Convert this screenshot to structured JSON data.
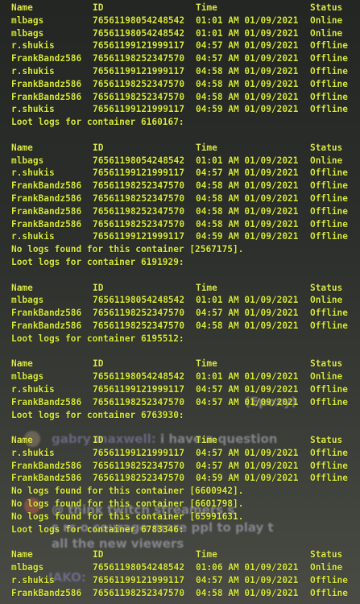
{
  "log": [
    {
      "type": "header",
      "name": "Name",
      "id": "ID",
      "time": "Time",
      "status": "Status"
    },
    {
      "type": "row",
      "name": "mlbags",
      "id": "76561198054248542",
      "time": "01:01 AM 01/09/2021",
      "status": "Online"
    },
    {
      "type": "row",
      "name": "mlbags",
      "id": "76561198054248542",
      "time": "01:01 AM 01/09/2021",
      "status": "Online"
    },
    {
      "type": "row",
      "name": "r.shukis",
      "id": "76561199121999117",
      "time": "04:57 AM 01/09/2021",
      "status": "Offline"
    },
    {
      "type": "row",
      "name": "FrankBandz586",
      "id": "76561198252347570",
      "time": "04:57 AM 01/09/2021",
      "status": "Offline"
    },
    {
      "type": "row",
      "name": "r.shukis",
      "id": "76561199121999117",
      "time": "04:58 AM 01/09/2021",
      "status": "Offline"
    },
    {
      "type": "row",
      "name": "FrankBandz586",
      "id": "76561198252347570",
      "time": "04:58 AM 01/09/2021",
      "status": "Offline"
    },
    {
      "type": "row",
      "name": "FrankBandz586",
      "id": "76561198252347570",
      "time": "04:58 AM 01/09/2021",
      "status": "Offline"
    },
    {
      "type": "row",
      "name": "r.shukis",
      "id": "76561199121999117",
      "time": "04:59 AM 01/09/2021",
      "status": "Offline"
    },
    {
      "type": "msg",
      "text": "Loot logs for container 6160167:"
    },
    {
      "type": "blank"
    },
    {
      "type": "header",
      "name": "Name",
      "id": "ID",
      "time": "Time",
      "status": "Status"
    },
    {
      "type": "row",
      "name": "mlbags",
      "id": "76561198054248542",
      "time": "01:01 AM 01/09/2021",
      "status": "Online"
    },
    {
      "type": "row",
      "name": "r.shukis",
      "id": "76561199121999117",
      "time": "04:57 AM 01/09/2021",
      "status": "Offline"
    },
    {
      "type": "row",
      "name": "FrankBandz586",
      "id": "76561198252347570",
      "time": "04:58 AM 01/09/2021",
      "status": "Offline"
    },
    {
      "type": "row",
      "name": "FrankBandz586",
      "id": "76561198252347570",
      "time": "04:58 AM 01/09/2021",
      "status": "Offline"
    },
    {
      "type": "row",
      "name": "FrankBandz586",
      "id": "76561198252347570",
      "time": "04:58 AM 01/09/2021",
      "status": "Offline"
    },
    {
      "type": "row",
      "name": "FrankBandz586",
      "id": "76561198252347570",
      "time": "04:58 AM 01/09/2021",
      "status": "Offline"
    },
    {
      "type": "row",
      "name": "r.shukis",
      "id": "76561199121999117",
      "time": "04:59 AM 01/09/2021",
      "status": "Offline"
    },
    {
      "type": "msg",
      "text": "No logs found for this container [2567175]."
    },
    {
      "type": "msg",
      "text": "Loot logs for container 6191929:"
    },
    {
      "type": "blank"
    },
    {
      "type": "header",
      "name": "Name",
      "id": "ID",
      "time": "Time",
      "status": "Status"
    },
    {
      "type": "row",
      "name": "mlbags",
      "id": "76561198054248542",
      "time": "01:01 AM 01/09/2021",
      "status": "Online"
    },
    {
      "type": "row",
      "name": "FrankBandz586",
      "id": "76561198252347570",
      "time": "04:57 AM 01/09/2021",
      "status": "Offline"
    },
    {
      "type": "row",
      "name": "FrankBandz586",
      "id": "76561198252347570",
      "time": "04:58 AM 01/09/2021",
      "status": "Offline"
    },
    {
      "type": "msg",
      "text": "Loot logs for container 6195512:"
    },
    {
      "type": "blank"
    },
    {
      "type": "header",
      "name": "Name",
      "id": "ID",
      "time": "Time",
      "status": "Status"
    },
    {
      "type": "row",
      "name": "mlbags",
      "id": "76561198054248542",
      "time": "01:01 AM 01/09/2021",
      "status": "Online"
    },
    {
      "type": "row",
      "name": "r.shukis",
      "id": "76561199121999117",
      "time": "04:57 AM 01/09/2021",
      "status": "Offline"
    },
    {
      "type": "row",
      "name": "FrankBandz586",
      "id": "76561198252347570",
      "time": "04:57 AM 01/09/2021",
      "status": "Offline"
    },
    {
      "type": "msg",
      "text": "Loot logs for container 6763930:"
    },
    {
      "type": "blank"
    },
    {
      "type": "header",
      "name": "Name",
      "id": "ID",
      "time": "Time",
      "status": "Status"
    },
    {
      "type": "row",
      "name": "r.shukis",
      "id": "76561199121999117",
      "time": "04:57 AM 01/09/2021",
      "status": "Offline"
    },
    {
      "type": "row",
      "name": "FrankBandz586",
      "id": "76561198252347570",
      "time": "04:57 AM 01/09/2021",
      "status": "Offline"
    },
    {
      "type": "row",
      "name": "FrankBandz586",
      "id": "76561198252347570",
      "time": "04:59 AM 01/09/2021",
      "status": "Offline"
    },
    {
      "type": "msg",
      "text": "No logs found for this container [6600942]."
    },
    {
      "type": "msg",
      "text": "No logs found for this container [6601798]."
    },
    {
      "type": "msg",
      "text": "No logs found for this container [65991631."
    },
    {
      "type": "msg",
      "text": "Loot logs for container 6783346:"
    },
    {
      "type": "blank"
    },
    {
      "type": "header",
      "name": "Name",
      "id": "ID",
      "time": "Time",
      "status": "Status"
    },
    {
      "type": "row",
      "name": "mlbags",
      "id": "76561198054248542",
      "time": "01:06 AM 01/09/2021",
      "status": "Online"
    },
    {
      "type": "row",
      "name": "r.shukis",
      "id": "76561199121999117",
      "time": "04:57 AM 01/09/2021",
      "status": "Offline"
    },
    {
      "type": "row",
      "name": "FrankBandz586",
      "id": "76561198252347570",
      "time": "04:58 AM 01/09/2021",
      "status": "Offline"
    }
  ],
  "chat": {
    "line1_text": "(Epoxy)",
    "line2_name": "gabry  maxwell:",
    "line2_text": "i have a question",
    "line3_text": "@          think  twitch streamers s",
    "line4_text": "s   rs   o     courage more ppl to play t",
    "line5_text": "all the new viewers",
    "line6_name": "JAKO:"
  }
}
